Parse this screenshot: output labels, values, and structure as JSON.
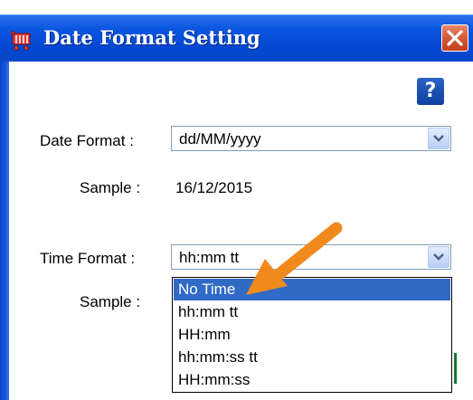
{
  "window": {
    "title": "Date Format Setting",
    "title_icon": "cart-icon",
    "close_icon": "close-icon"
  },
  "help": {
    "label": "?"
  },
  "date_format": {
    "label": "Date Format :",
    "value": "dd/MM/yyyy",
    "sample_label": "Sample :",
    "sample_value": "16/12/2015"
  },
  "time_format": {
    "label": "Time Format :",
    "value": "hh:mm tt",
    "sample_label": "Sample :",
    "options": [
      "No Time",
      "hh:mm tt",
      "HH:mm",
      "hh:mm:ss tt",
      "HH:mm:ss"
    ],
    "highlighted_option": "No Time"
  },
  "colors": {
    "title_bar": "#0a55e0",
    "selection": "#316ac5",
    "annotation_arrow": "#f08a1c",
    "close_button": "#d0522e"
  }
}
